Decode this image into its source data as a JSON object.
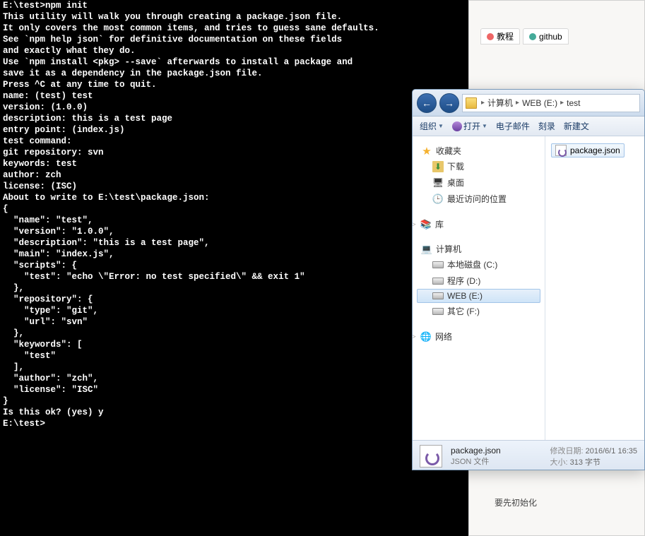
{
  "terminal": {
    "lines": [
      "E:\\test>npm init",
      "This utility will walk you through creating a package.json file.",
      "It only covers the most common items, and tries to guess sane defaults.",
      "",
      "See `npm help json` for definitive documentation on these fields",
      "and exactly what they do.",
      "",
      "Use `npm install <pkg> --save` afterwards to install a package and",
      "save it as a dependency in the package.json file.",
      "",
      "Press ^C at any time to quit.",
      "name: (test) test",
      "version: (1.0.0)",
      "description: this is a test page",
      "entry point: (index.js)",
      "test command:",
      "git repository: svn",
      "keywords: test",
      "author: zch",
      "license: (ISC)",
      "About to write to E:\\test\\package.json:",
      "",
      "{",
      "  \"name\": \"test\",",
      "  \"version\": \"1.0.0\",",
      "  \"description\": \"this is a test page\",",
      "  \"main\": \"index.js\",",
      "  \"scripts\": {",
      "    \"test\": \"echo \\\"Error: no test specified\\\" && exit 1\"",
      "  },",
      "  \"repository\": {",
      "    \"type\": \"git\",",
      "    \"url\": \"svn\"",
      "  },",
      "  \"keywords\": [",
      "    \"test\"",
      "  ],",
      "  \"author\": \"zch\",",
      "  \"license\": \"ISC\"",
      "}",
      "",
      "",
      "Is this ok? (yes) y",
      "",
      "E:\\test>"
    ]
  },
  "bgTabs": {
    "tab1": "教程",
    "tab2": "github"
  },
  "bgNote": "要先初始化",
  "explorer": {
    "nav": {
      "back_arrow": "←",
      "fwd_arrow": "→"
    },
    "breadcrumb": {
      "c1": "计算机",
      "c2": "WEB (E:)",
      "c3": "test",
      "arrow": "▸"
    },
    "menu": {
      "organize": "组织",
      "open": "打开",
      "email": "电子邮件",
      "burn": "刻录",
      "newfile": "新建文"
    },
    "sidebar": {
      "fav_head": "收藏夹",
      "fav_downloads": "下载",
      "fav_desktop": "桌面",
      "fav_recent": "最近访问的位置",
      "lib_head": "库",
      "comp_head": "计算机",
      "disk_c": "本地磁盘 (C:)",
      "disk_d": "程序 (D:)",
      "disk_e": "WEB (E:)",
      "disk_f": "其它 (F:)",
      "net_head": "网络"
    },
    "file": {
      "name": "package.json"
    },
    "status": {
      "name": "package.json",
      "type": "JSON 文件",
      "date_label": "修改日期:",
      "date": "2016/6/1 16:35",
      "size_label": "大小:",
      "size": "313 字节"
    }
  }
}
